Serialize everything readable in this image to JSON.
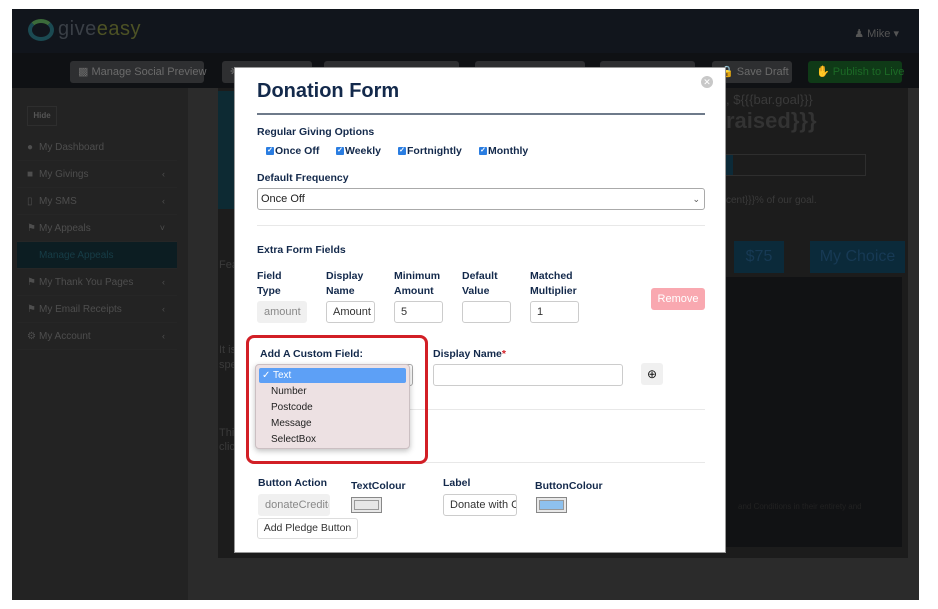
{
  "app": {
    "brand": {
      "prefix": "give",
      "suffix": "easy"
    },
    "user_menu": {
      "icon": "user-icon",
      "label": "Mike",
      "caret": "caret-down-icon"
    }
  },
  "toolbar": {
    "buttons": [
      {
        "label": "Manage Social Preview",
        "icon": "share-icon"
      },
      {
        "label": "",
        "icon": "paw-icon"
      },
      {
        "label": ""
      },
      {
        "label": ""
      },
      {
        "label": ""
      },
      {
        "label": "Save Draft",
        "icon": "lock-icon"
      },
      {
        "label": "Publish to Live",
        "icon": "thumbs-up-icon"
      }
    ]
  },
  "sidebar": {
    "hide_label": "Hide",
    "items": [
      {
        "label": "My Dashboard",
        "icon": "dashboard-icon",
        "chevron": ""
      },
      {
        "label": "My Givings",
        "icon": "gift-icon",
        "chevron": "‹"
      },
      {
        "label": "My SMS",
        "icon": "mobile-icon",
        "chevron": "‹"
      },
      {
        "label": "My Appeals",
        "icon": "flag-icon",
        "chevron": "˅"
      },
      {
        "label": "Manage Appeals",
        "icon": "",
        "chevron": "",
        "active": true
      },
      {
        "label": "My Thank You Pages",
        "icon": "flag-icon",
        "chevron": "‹"
      },
      {
        "label": "My Email Receipts",
        "icon": "flag-icon",
        "chevron": "‹"
      },
      {
        "label": "My Account",
        "icon": "gear-icon",
        "chevron": "‹"
      }
    ]
  },
  "background": {
    "goal_text": ", ${{{bar.goal}}}",
    "raised_text": "raised}}}",
    "percent_text": "cent}}}% of our goal.",
    "amount_75": "$75",
    "my_choice": "My Choice",
    "features_fragment": "Fea",
    "it_is_fragment": "It is",
    "spe_fragment": "spe",
    "this_fragment": "This",
    "click_fragment": "click",
    "terms_fragment": "and Conditions in their entirety and"
  },
  "modal": {
    "title": "Donation Form",
    "regular_giving": {
      "label": "Regular Giving Options",
      "options": [
        {
          "label": "Once Off",
          "checked": true
        },
        {
          "label": "Weekly",
          "checked": true
        },
        {
          "label": "Fortnightly",
          "checked": true
        },
        {
          "label": "Monthly",
          "checked": true
        }
      ]
    },
    "default_frequency": {
      "label": "Default Frequency",
      "value": "Once Off"
    },
    "extra_fields": {
      "label": "Extra Form Fields",
      "headers": [
        {
          "line1": "Field",
          "line2": "Type"
        },
        {
          "line1": "Display",
          "line2": "Name"
        },
        {
          "line1": "Minimum",
          "line2": "Amount"
        },
        {
          "line1": "Default",
          "line2": "Value"
        },
        {
          "line1": "Matched",
          "line2": "Multiplier"
        }
      ],
      "row": {
        "field_type": "amount",
        "display_name": "Amount",
        "minimum_amount": "5",
        "default_value": "",
        "matched_multiplier": "1"
      },
      "remove_label": "Remove"
    },
    "custom_field": {
      "label": "Add A Custom Field:",
      "display_name_label": "Display Name",
      "required_marker": "*",
      "display_name_value": "",
      "options": [
        "Text",
        "Number",
        "Postcode",
        "Message",
        "SelectBox"
      ],
      "selected": "Text",
      "add_icon": "plus-circle-icon"
    },
    "pledge": {
      "button_action_label": "Button Action",
      "button_action_value": "donateCredit(",
      "text_colour_label": "TextColour",
      "text_colour": "#e6e6e6",
      "label_label": "Label",
      "label_value": "Donate with C",
      "button_colour_label": "ButtonColour",
      "button_colour": "#8ec1ee",
      "add_button_label": "Add Pledge Button"
    }
  }
}
